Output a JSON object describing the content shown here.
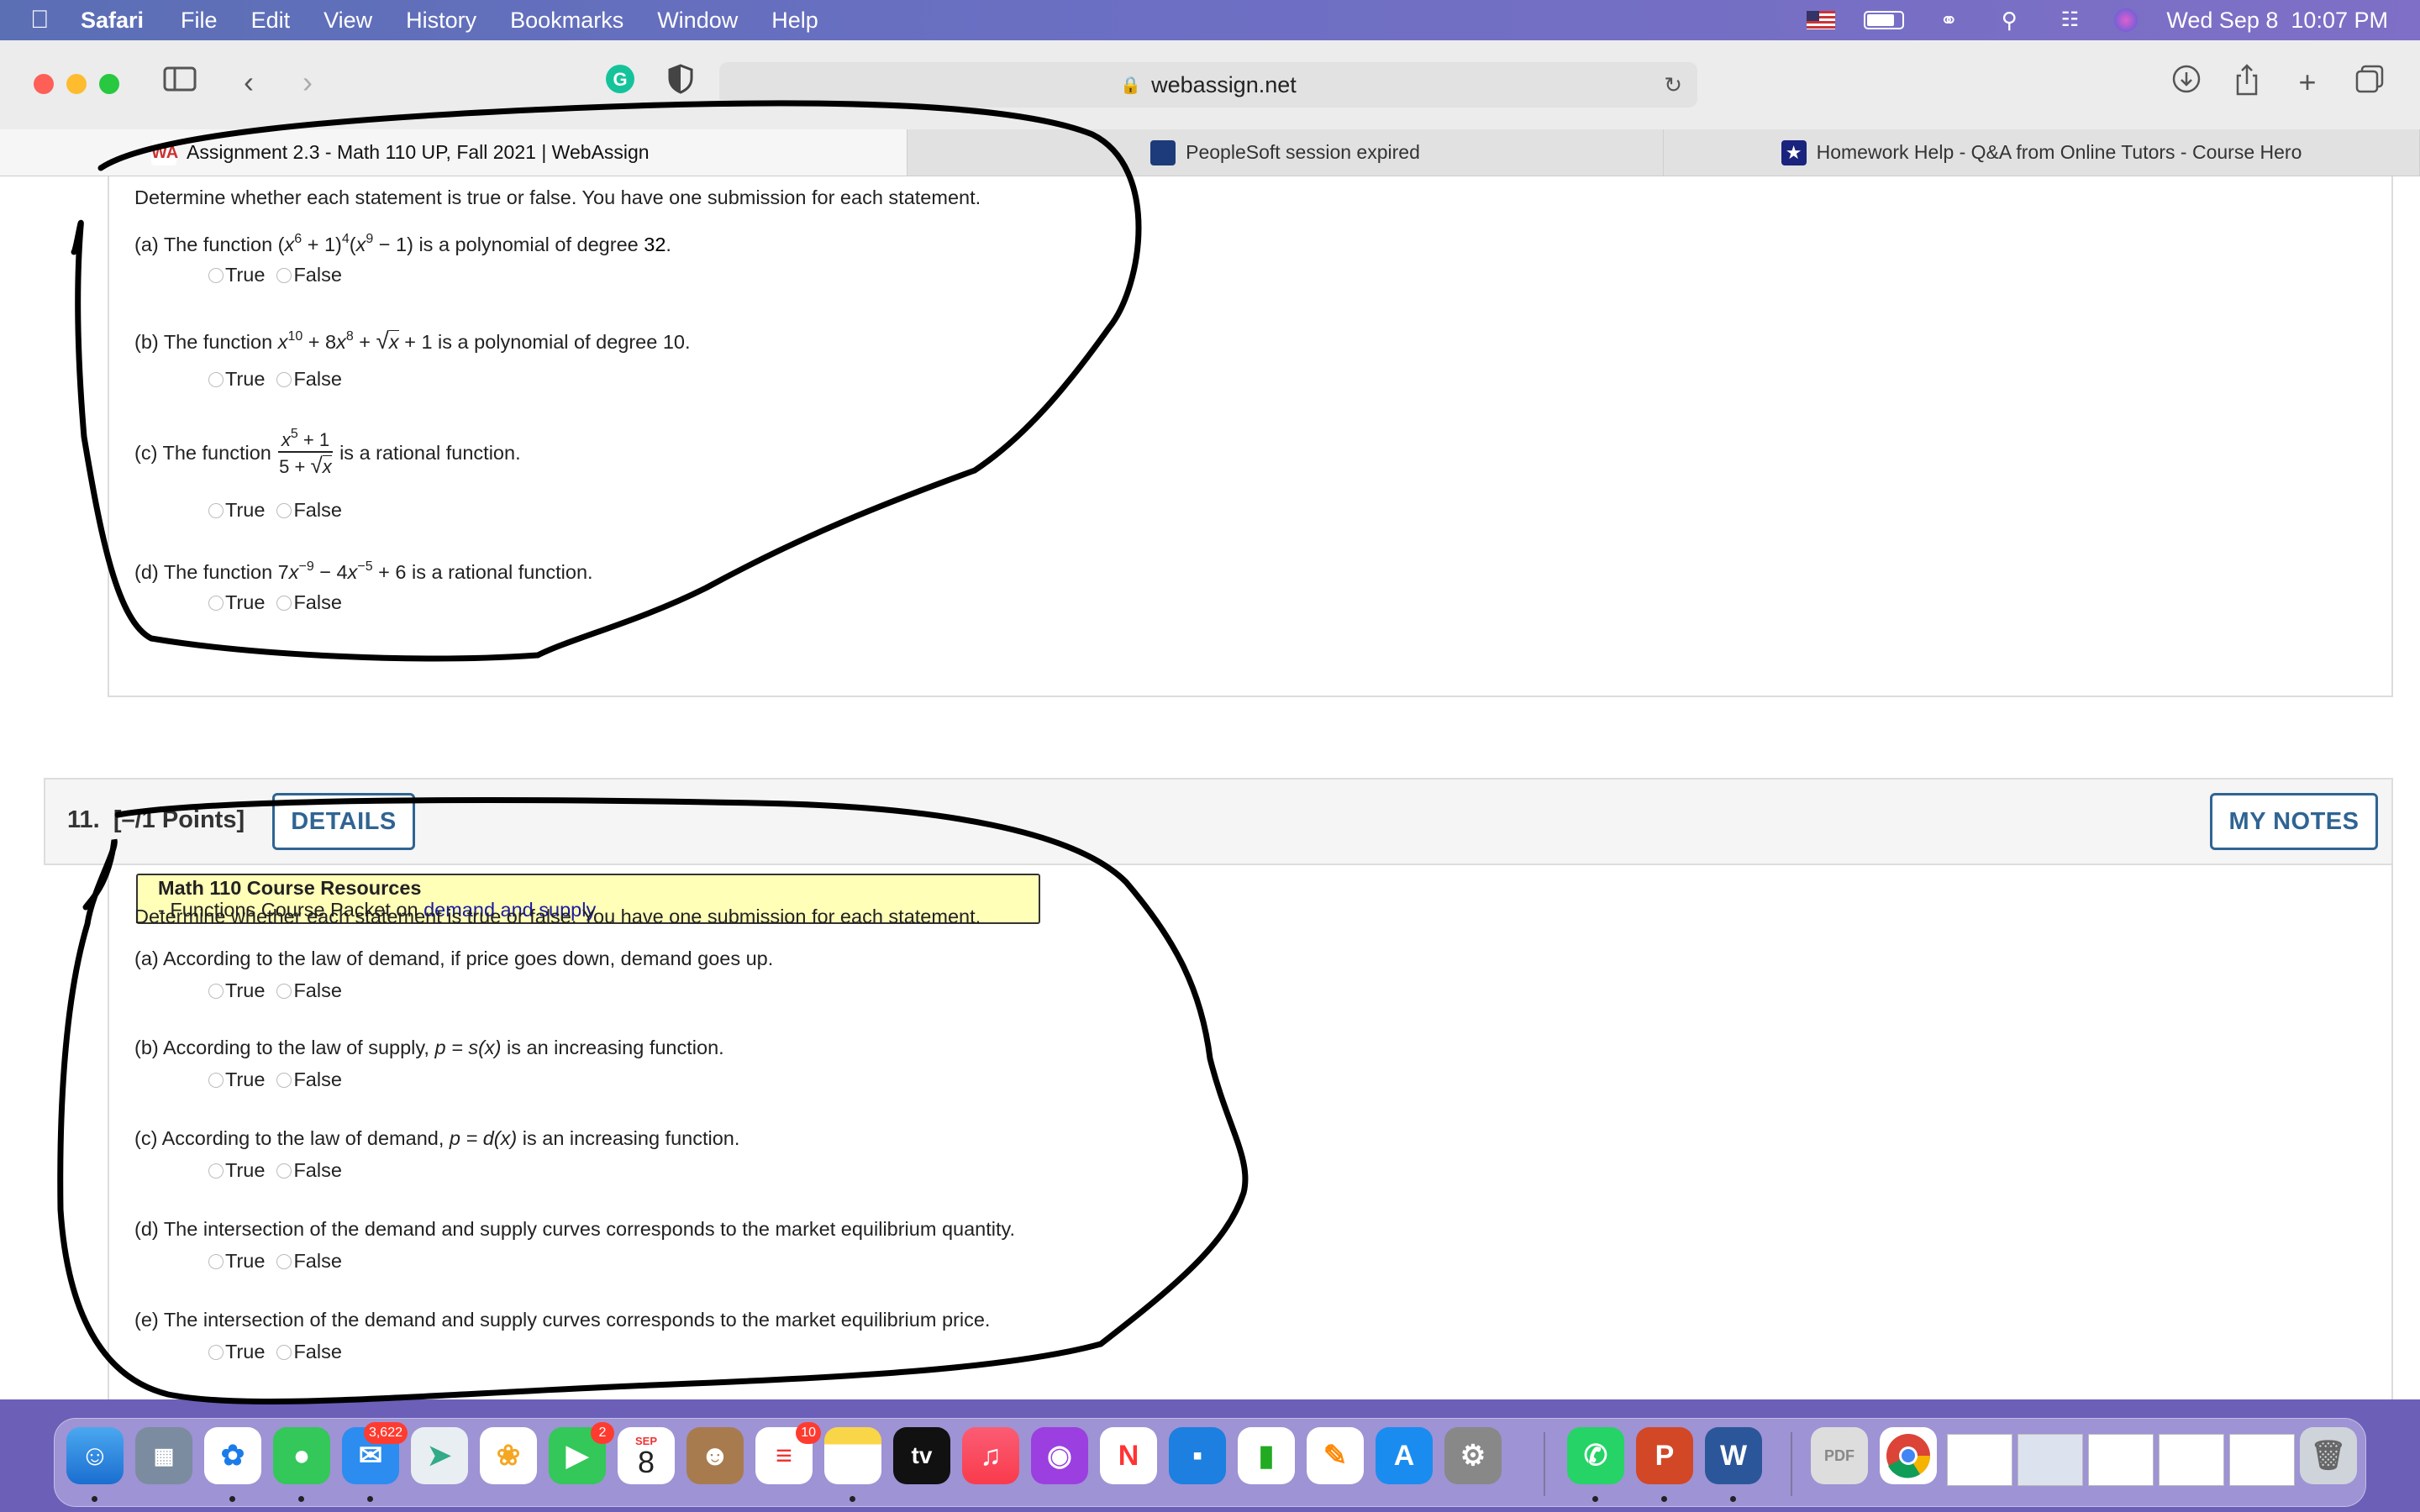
{
  "menubar": {
    "app_name": "Safari",
    "items": [
      "File",
      "Edit",
      "View",
      "History",
      "Bookmarks",
      "Window",
      "Help"
    ],
    "clock": "Wed Sep 8  10:07 PM"
  },
  "browser": {
    "url": "webassign.net",
    "tabs": [
      {
        "title": "Assignment 2.3 - Math 110 UP, Fall 2021 | WebAssign"
      },
      {
        "title": "PeopleSoft session expired"
      },
      {
        "title": "Homework Help - Q&A from Online Tutors - Course Hero"
      }
    ]
  },
  "q10": {
    "intro": "Determine whether each statement is true or false. You have one submission for each statement.",
    "statements": [
      {
        "prefix": "(a) The function (",
        "mid1": "x",
        "sup1": "6",
        "mid2": " + 1)",
        "sup2": "4",
        "mid3": "(",
        "mid4": "x",
        "sup3": "9",
        "mid5": " − 1) is a polynomial of degree ",
        "value": "32",
        "suffix": "."
      },
      {
        "prefix": "(b) The function ",
        "mid1": "x",
        "sup1": "10",
        "mid2": " + 8",
        "mid3": "x",
        "sup2": "8",
        "mid4": " + ",
        "root": "x",
        "mid5": " + 1 is a polynomial of degree ",
        "value": "10",
        "suffix": "."
      },
      {
        "prefix": "(c) The function",
        "num_base": "x",
        "num_sup": "5",
        "num_rest": " + 1",
        "den_pre": "5 + ",
        "den_root": "x",
        "suffix": "is a rational function."
      },
      {
        "prefix": "(d) The function 7",
        "mid1": "x",
        "sup1": "−9",
        "mid2": " − 4",
        "mid3": "x",
        "sup2": "−5",
        "mid4": " + 6 is a rational function."
      }
    ]
  },
  "options": {
    "true_label": "True",
    "false_label": "False"
  },
  "q11": {
    "number": "11.  [–/1 Points]",
    "details_button": "DETAILS",
    "notes_button": "MY NOTES",
    "resources_title": "Math 110 Course Resources",
    "resources_line": "- Functions Course Packet on ",
    "resources_link": "demand and supply",
    "intro": "Determine whether each statement is true or false. You have one submission for each statement.",
    "statements": [
      {
        "pre": "(a) According to the law of demand, if price goes down, demand goes up.",
        "math": "",
        "post": ""
      },
      {
        "pre": "(b) According to the law of supply, ",
        "math": "p = s(x)",
        "post": " is an increasing function."
      },
      {
        "pre": "(c) According to the law of demand, ",
        "math": "p = d(x)",
        "post": " is an increasing function."
      },
      {
        "pre": "(d) The intersection of the demand and supply curves corresponds to the market equilibrium quantity.",
        "math": "",
        "post": ""
      },
      {
        "pre": "(e) The intersection of the demand and supply curves corresponds to the market equilibrium price.",
        "math": "",
        "post": ""
      }
    ]
  },
  "dock": {
    "mail_badge": "3,622",
    "facetime_badge": "2",
    "reminders_badge": "10",
    "calendar_month": "SEP",
    "calendar_day": "8",
    "tv_label": "tv"
  }
}
